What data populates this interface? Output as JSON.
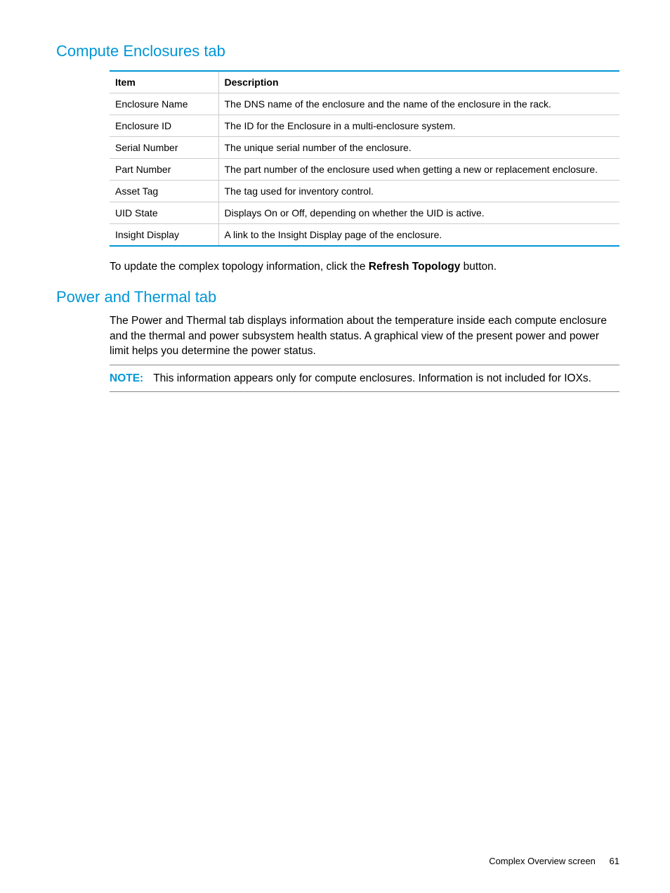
{
  "section1": {
    "heading": "Compute Enclosures tab",
    "table": {
      "headers": {
        "col1": "Item",
        "col2": "Description"
      },
      "rows": [
        {
          "item": "Enclosure Name",
          "desc": "The DNS name of the enclosure and the name of the enclosure in the rack."
        },
        {
          "item": "Enclosure ID",
          "desc": "The ID for the Enclosure in a multi-enclosure system."
        },
        {
          "item": "Serial Number",
          "desc": "The unique serial number of the enclosure."
        },
        {
          "item": "Part Number",
          "desc": "The part number of the enclosure used when getting a new or replacement enclosure."
        },
        {
          "item": "Asset Tag",
          "desc": "The tag used for inventory control."
        },
        {
          "item": "UID State",
          "desc": "Displays On or Off, depending on whether the UID is active."
        },
        {
          "item": "Insight Display",
          "desc": "A link to the Insight Display page of the enclosure."
        }
      ]
    },
    "para_pre": "To update the complex topology information, click the ",
    "para_bold": "Refresh Topology",
    "para_post": " button."
  },
  "section2": {
    "heading": "Power and Thermal tab",
    "para": "The Power and Thermal tab displays information about the temperature inside each compute enclosure and the thermal and power subsystem health status. A graphical view of the present power and power limit helps you determine the power status.",
    "note_label": "NOTE:",
    "note_text": "This information appears only for compute enclosures. Information is not included for IOXs."
  },
  "footer": {
    "text": "Complex Overview screen",
    "page": "61"
  }
}
